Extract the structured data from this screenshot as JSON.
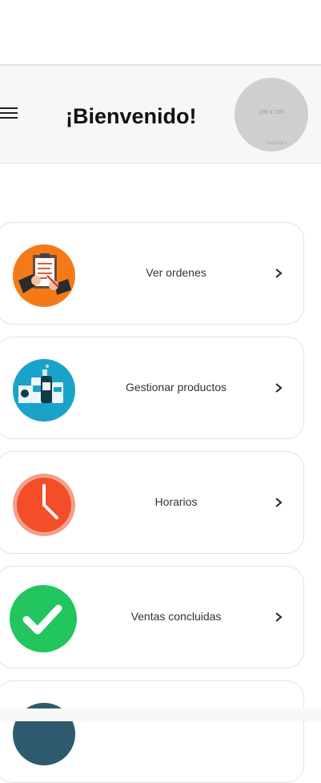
{
  "header": {
    "title": "¡Bienvenido!"
  },
  "avatar": {
    "placeholder": "200 x 200",
    "credit": "placehold.it"
  },
  "menu": [
    {
      "label": "Ver ordenes",
      "icon": "clipboard-order-icon",
      "color": "#f47a19"
    },
    {
      "label": "Gestionar productos",
      "icon": "products-icon",
      "color": "#1aa3c9"
    },
    {
      "label": "Horarios",
      "icon": "clock-icon",
      "color": "#f34d2a"
    },
    {
      "label": "Ventas concluidas",
      "icon": "check-icon",
      "color": "#22c55e"
    }
  ]
}
